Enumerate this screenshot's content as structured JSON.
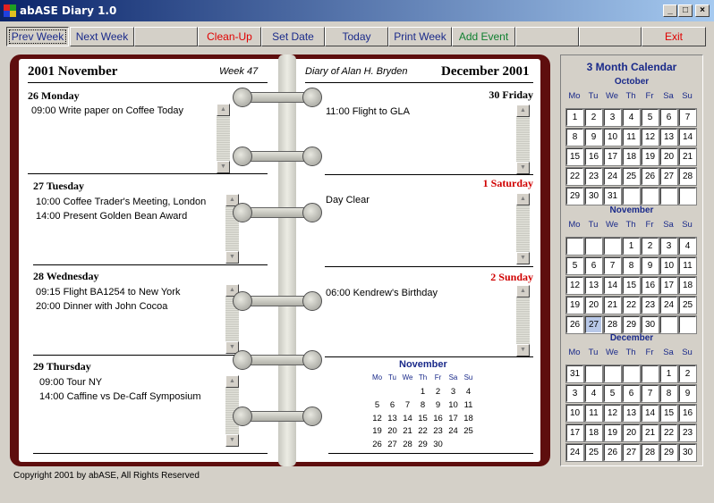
{
  "window": {
    "title": "abASE Diary 1.0",
    "minimize": "_",
    "maximize": "□",
    "close": "×"
  },
  "toolbar": {
    "prev_week": "Prev Week",
    "next_week": "Next Week",
    "clean_up": "Clean-Up",
    "set_date": "Set Date",
    "today": "Today",
    "print_week": "Print Week",
    "add_event": "Add Event",
    "exit": "Exit"
  },
  "left_page": {
    "month_heading": "2001 November",
    "week": "Week 47",
    "days": [
      {
        "heading": "26 Monday",
        "entries": [
          "09:00 Write paper on Coffee Today"
        ]
      },
      {
        "heading": "27 Tuesday",
        "entries": [
          "10:00 Coffee Trader's Meeting, London",
          "14:00 Present Golden Bean Award"
        ]
      },
      {
        "heading": "28 Wednesday",
        "entries": [
          "09:15 Flight BA1254 to New York",
          "20:00 Dinner with John Cocoa"
        ]
      },
      {
        "heading": "29 Thursday",
        "entries": [
          "09:00 Tour NY",
          "14:00 Caffine vs De-Caff Symposium"
        ]
      }
    ]
  },
  "right_page": {
    "diary_of": "Diary of Alan H. Bryden",
    "month_heading": "December 2001",
    "days": [
      {
        "heading": "30 Friday",
        "weekend": false,
        "entries": [
          "11:00 Flight to GLA"
        ]
      },
      {
        "heading": "1 Saturday",
        "weekend": true,
        "entries": [
          "Day Clear"
        ]
      },
      {
        "heading": "2 Sunday",
        "weekend": true,
        "entries": [
          "06:00 Kendrew's Birthday"
        ]
      }
    ],
    "mini_calendar": {
      "title": "November",
      "dow": [
        "Mo",
        "Tu",
        "We",
        "Th",
        "Fr",
        "Sa",
        "Su"
      ],
      "weeks": [
        [
          "",
          "",
          "",
          "1",
          "2",
          "3",
          "4"
        ],
        [
          "5",
          "6",
          "7",
          "8",
          "9",
          "10",
          "11"
        ],
        [
          "12",
          "13",
          "14",
          "15",
          "16",
          "17",
          "18"
        ],
        [
          "19",
          "20",
          "21",
          "22",
          "23",
          "24",
          "25"
        ],
        [
          "26",
          "27",
          "28",
          "29",
          "30",
          "",
          ""
        ]
      ]
    }
  },
  "calendar_panel": {
    "title": "3 Month Calendar",
    "dow": [
      "Mo",
      "Tu",
      "We",
      "Th",
      "Fr",
      "Sa",
      "Su"
    ],
    "months": [
      {
        "name": "October",
        "weeks": [
          [
            "1",
            "2",
            "3",
            "4",
            "5",
            "6",
            "7"
          ],
          [
            "8",
            "9",
            "10",
            "11",
            "12",
            "13",
            "14"
          ],
          [
            "15",
            "16",
            "17",
            "18",
            "19",
            "20",
            "21"
          ],
          [
            "22",
            "23",
            "24",
            "25",
            "26",
            "27",
            "28"
          ],
          [
            "29",
            "30",
            "31",
            "",
            "",
            "",
            ""
          ]
        ]
      },
      {
        "name": "November",
        "weeks": [
          [
            "",
            "",
            "",
            "1",
            "2",
            "3",
            "4"
          ],
          [
            "5",
            "6",
            "7",
            "8",
            "9",
            "10",
            "11"
          ],
          [
            "12",
            "13",
            "14",
            "15",
            "16",
            "17",
            "18"
          ],
          [
            "19",
            "20",
            "21",
            "22",
            "23",
            "24",
            "25"
          ],
          [
            "26",
            "27",
            "28",
            "29",
            "30",
            "",
            ""
          ]
        ]
      },
      {
        "name": "December",
        "weeks": [
          [
            "31",
            "",
            "",
            "",
            "",
            "1",
            "2"
          ],
          [
            "3",
            "4",
            "5",
            "6",
            "7",
            "8",
            "9"
          ],
          [
            "10",
            "11",
            "12",
            "13",
            "14",
            "15",
            "16"
          ],
          [
            "17",
            "18",
            "19",
            "20",
            "21",
            "22",
            "23"
          ],
          [
            "24",
            "25",
            "26",
            "27",
            "28",
            "29",
            "30"
          ]
        ]
      }
    ],
    "highlighted": {
      "month": "November",
      "day": "27"
    }
  },
  "footer": "Copyright 2001 by abASE, All Rights Reserved",
  "colors": {
    "accent": "#1a2a8a",
    "weekend": "#d00000",
    "book": "#5e0e0e",
    "add_event": "#108030"
  }
}
